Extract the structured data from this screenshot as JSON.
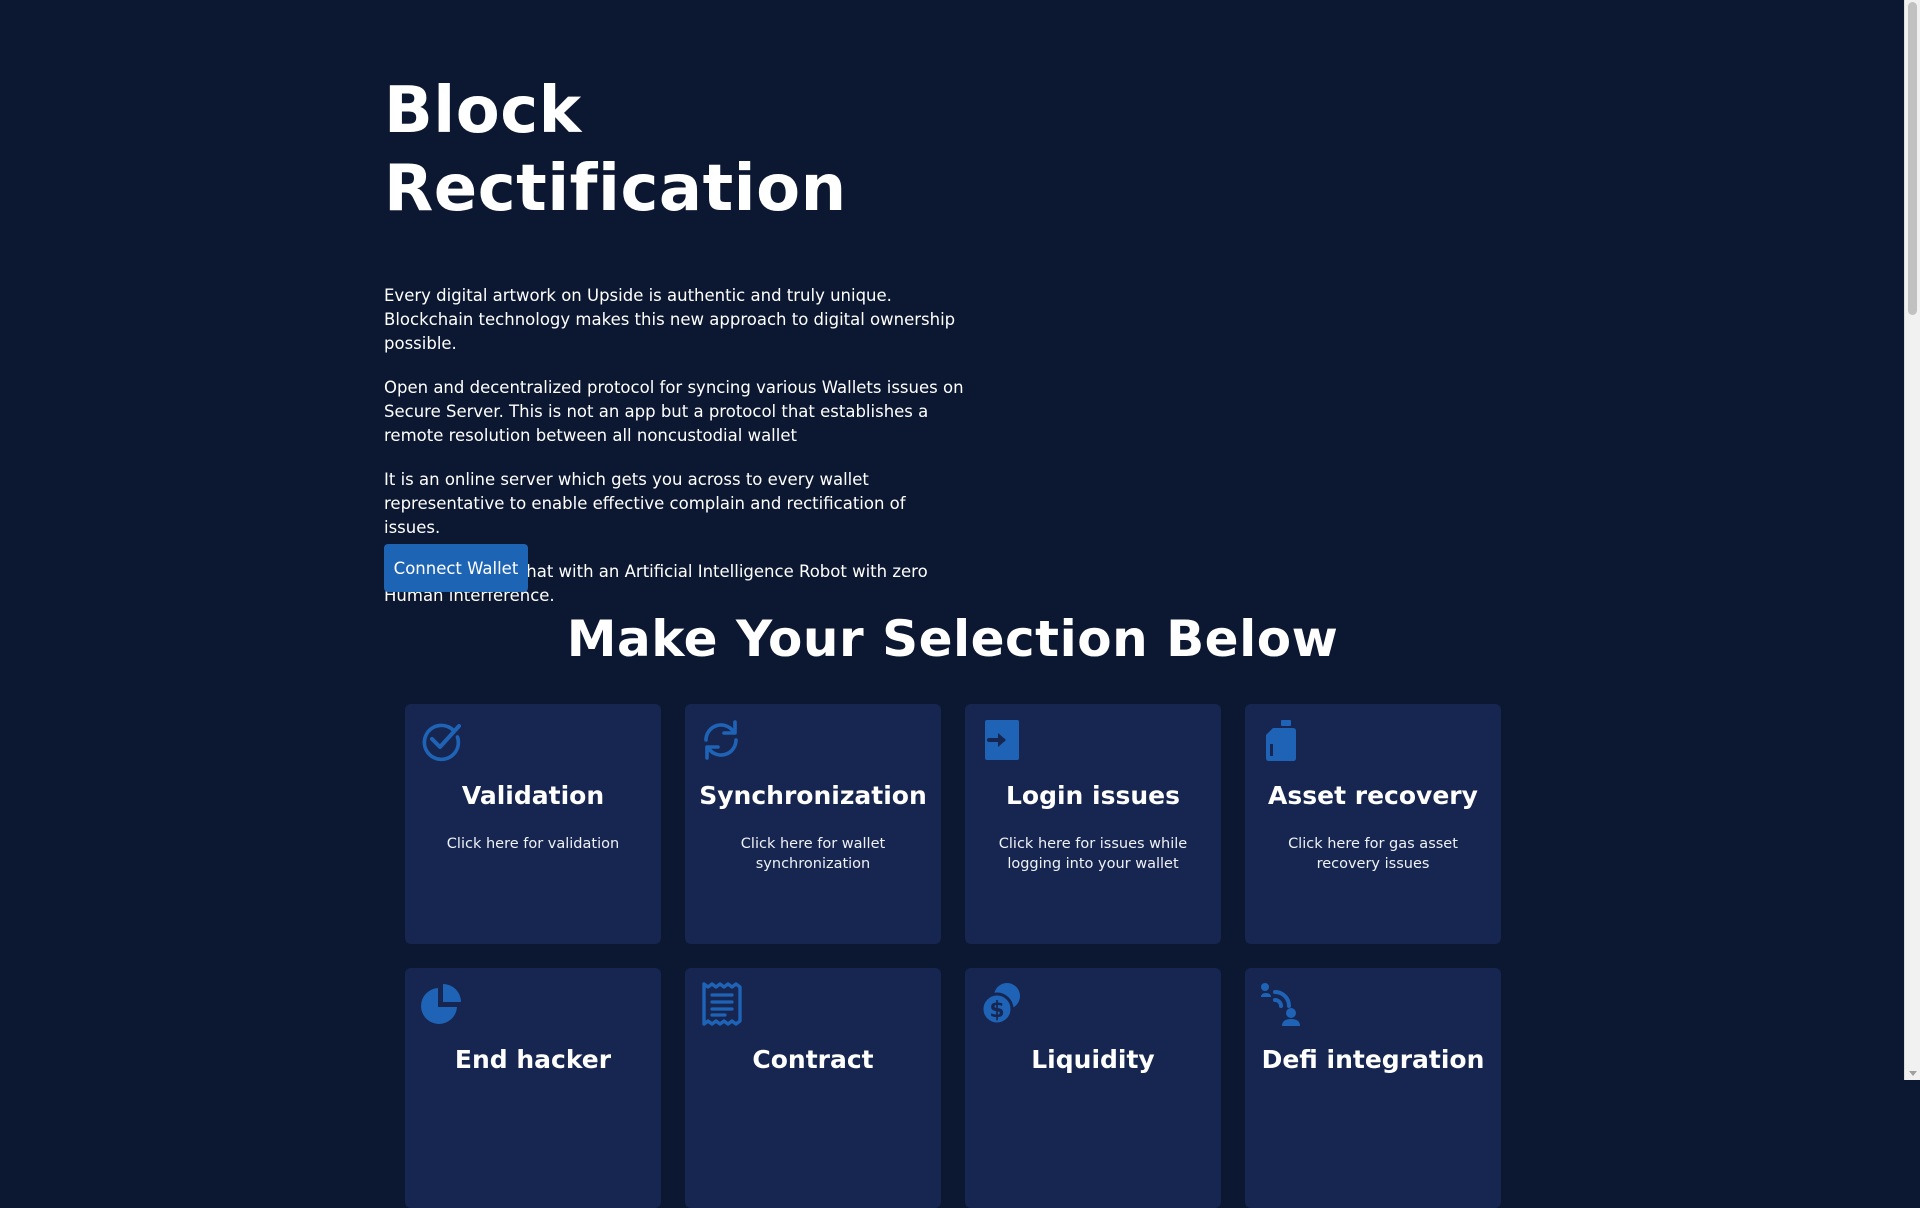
{
  "hero": {
    "title": "Block Rectification",
    "paragraphs": [
      "Every digital artwork on Upside is authentic and truly unique. Blockchain technology makes this new approach to digital ownership possible.",
      "Open and decentralized protocol for syncing various Wallets issues on Secure Server. This is not an app but a protocol that establishes a remote resolution between all noncustodial wallet",
      "It is an online server which gets you across to every wallet representative to enable effective complain and rectification of issues.",
      "You will be on a chat with an Artificial Intelligence Robot with zero Human interference."
    ],
    "connect_label": "Connect Wallet"
  },
  "section": {
    "title": "Make Your Selection Below"
  },
  "cards": [
    {
      "title": "Validation",
      "desc": "Click here for validation",
      "icon": "check-circle-icon"
    },
    {
      "title": "Synchronization",
      "desc": "Click here for wallet synchronization",
      "icon": "refresh-icon"
    },
    {
      "title": "Login issues",
      "desc": "Click here for issues while logging into your wallet",
      "icon": "login-icon"
    },
    {
      "title": "Asset recovery",
      "desc": "Click here for gas asset recovery issues",
      "icon": "gas-canister-icon"
    },
    {
      "title": "End hacker",
      "desc": "",
      "icon": "pie-chart-icon"
    },
    {
      "title": "Contract",
      "desc": "",
      "icon": "receipt-icon"
    },
    {
      "title": "Liquidity",
      "desc": "",
      "icon": "coins-icon"
    },
    {
      "title": "Defi integration",
      "desc": "",
      "icon": "signal-user-icon"
    }
  ],
  "colors": {
    "background": "#0c1832",
    "card": "#172650",
    "accent": "#1e64b4",
    "icon": "#1f63b6"
  }
}
